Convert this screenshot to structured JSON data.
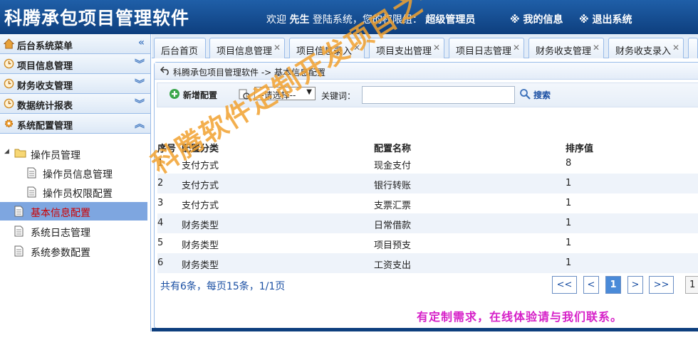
{
  "header": {
    "title": "科腾承包项目管理软件",
    "welcome_prefix": "欢迎",
    "user_name": "先生",
    "welcome_mid": "登陆系统，您的权限组：",
    "role": "超级管理员",
    "my_info": "※ 我的信息",
    "logout": "※ 退出系统"
  },
  "sidebar": {
    "menu_title": "后台系统菜单",
    "sections": [
      {
        "label": "项目信息管理",
        "icon": "clock-icon"
      },
      {
        "label": "财务收支管理",
        "icon": "clock-icon"
      },
      {
        "label": "数据统计报表",
        "icon": "clock-icon"
      },
      {
        "label": "系统配置管理",
        "icon": "gear-icon"
      }
    ],
    "tree": {
      "group": "操作员管理",
      "items": [
        "操作员信息管理",
        "操作员权限配置"
      ],
      "selected": "基本信息配置",
      "others": [
        "系统日志管理",
        "系统参数配置"
      ]
    }
  },
  "tabs": [
    {
      "label": "后台首页",
      "closable": false
    },
    {
      "label": "项目信息管理",
      "closable": true
    },
    {
      "label": "项目信息录入",
      "closable": true
    },
    {
      "label": "项目支出管理",
      "closable": true
    },
    {
      "label": "项目日志管理",
      "closable": true
    },
    {
      "label": "财务收支管理",
      "closable": true
    },
    {
      "label": "财务收支录入",
      "closable": true
    }
  ],
  "breadcrumb": "科腾承包项目管理软件 -> 基本信息配置",
  "toolbar": {
    "add_label": "新增配置",
    "select_value": "--请选择--",
    "keyword_label": "关键词：",
    "keyword_value": "",
    "search_label": "搜索"
  },
  "table": {
    "columns": [
      "序号",
      "配置分类",
      "配置名称",
      "排序值"
    ],
    "rows": [
      [
        "1",
        "支付方式",
        "现金支付",
        "8"
      ],
      [
        "2",
        "支付方式",
        "银行转账",
        "1"
      ],
      [
        "3",
        "支付方式",
        "支票汇票",
        "1"
      ],
      [
        "4",
        "财务类型",
        "日常借款",
        "1"
      ],
      [
        "5",
        "财务类型",
        "项目预支",
        "1"
      ],
      [
        "6",
        "财务类型",
        "工资支出",
        "1"
      ]
    ]
  },
  "pager": {
    "summary": "共有6条，每页15条，1/1页",
    "first": "<<",
    "prev": "<",
    "current": "1",
    "next": ">",
    "last": ">>",
    "jump_value": "1"
  },
  "contact": "有定制需求，在线体验请与我们联系。",
  "watermark": "科腾软件定制开发项目之一",
  "colors": {
    "header_bg": "#0e3f7e",
    "accent": "#4a8ad8",
    "selected_text": "#cc0000",
    "contact": "#d620c8",
    "watermark": "#f2a230"
  }
}
